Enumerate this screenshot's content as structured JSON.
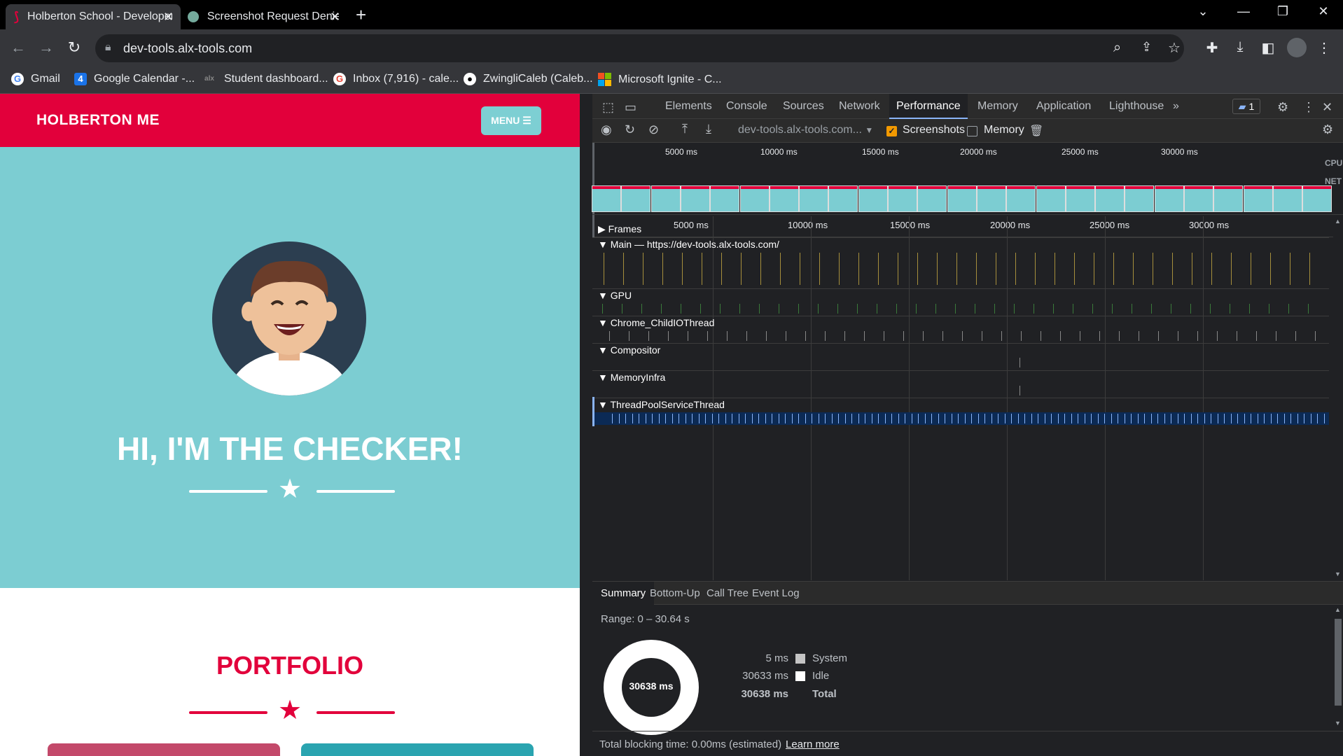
{
  "browser": {
    "tabs": [
      {
        "title": "Holberton School - Developer to",
        "active": true
      },
      {
        "title": "Screenshot Request Denied",
        "active": false
      }
    ],
    "new_tab": "+",
    "url": "dev-tools.alx-tools.com",
    "bookmarks": [
      {
        "label": "Gmail",
        "icon": "google-icon",
        "color": "#4285f4"
      },
      {
        "label": "Google Calendar -...",
        "icon": "calendar-icon",
        "color": "#1a73e8"
      },
      {
        "label": "Student dashboard...",
        "icon": "alx-icon",
        "color": "#555555"
      },
      {
        "label": "Inbox (7,916) - cale...",
        "icon": "google-icon",
        "color": "#ea4335"
      },
      {
        "label": "ZwingliCaleb (Caleb...",
        "icon": "github-icon",
        "color": "#ffffff"
      },
      {
        "label": "Microsoft Ignite - C...",
        "icon": "microsoft-icon",
        "color": "#f25022"
      }
    ]
  },
  "page": {
    "brand": "HOLBERTON ME",
    "menu_label": "MENU ☰",
    "hero_title": "HI, I'M THE CHECKER!",
    "section_title": "PORTFOLIO",
    "accent": "#e2003b",
    "hero_bg": "#7ccdd2"
  },
  "devtools": {
    "tabs": [
      "Elements",
      "Console",
      "Sources",
      "Network",
      "Performance",
      "Memory",
      "Application",
      "Lighthouse"
    ],
    "active_tab": "Performance",
    "more": "»",
    "issues_count": "1",
    "perf_url": "dev-tools.alx-tools.com...",
    "screenshots_label": "Screenshots",
    "screenshots_checked": true,
    "memory_label": "Memory",
    "memory_checked": false,
    "overview_ticks": [
      "5000 ms",
      "10000 ms",
      "15000 ms",
      "20000 ms",
      "25000 ms",
      "30000 ms"
    ],
    "cpu_label": "CPU",
    "net_label": "NET",
    "timeline_ticks": [
      "5000 ms",
      "10000 ms",
      "15000 ms",
      "20000 ms",
      "25000 ms",
      "30000 ms"
    ],
    "tracks": [
      {
        "label": "Frames",
        "expanded": false
      },
      {
        "label": "Main — https://dev-tools.alx-tools.com/",
        "expanded": true
      },
      {
        "label": "GPU",
        "expanded": true
      },
      {
        "label": "Chrome_ChildIOThread",
        "expanded": true
      },
      {
        "label": "Compositor",
        "expanded": true
      },
      {
        "label": "MemoryInfra",
        "expanded": true
      },
      {
        "label": "ThreadPoolServiceThread",
        "expanded": true
      }
    ],
    "summary_tabs": [
      "Summary",
      "Bottom-Up",
      "Call Tree",
      "Event Log"
    ],
    "range": "Range: 0 – 30.64 s",
    "donut_total": "30638 ms",
    "summary_rows": [
      {
        "value": "5 ms",
        "label": "System",
        "color": "#c4c4c4"
      },
      {
        "value": "30633 ms",
        "label": "Idle",
        "color": "#ffffff"
      }
    ],
    "total_value": "30638 ms",
    "total_label": "Total",
    "footer_text": "Total blocking time: 0.00ms (estimated)",
    "learn_more": "Learn more"
  }
}
